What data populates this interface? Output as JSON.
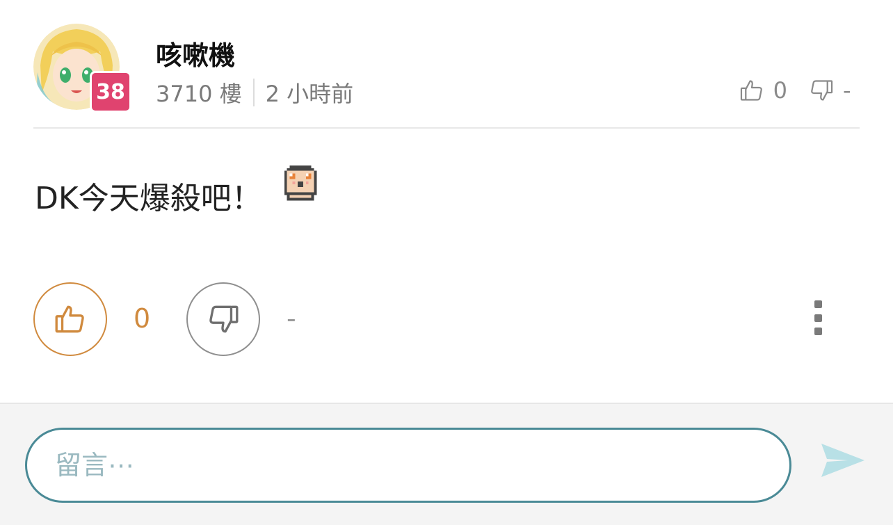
{
  "user": {
    "name": "咳嗽機",
    "level": "38",
    "avatar_icon": "anime-girl-avatar"
  },
  "meta": {
    "floor": "3710 樓",
    "time": "2 小時前"
  },
  "top_votes": {
    "like_icon": "thumbs-up-icon",
    "like_count": "0",
    "dislike_icon": "thumbs-down-icon",
    "dislike_count": "-"
  },
  "post": {
    "text": "DK今天爆殺吧！",
    "sticker": "pixel-emoji-sticker"
  },
  "actions": {
    "like_count": "0",
    "dislike_count": "-",
    "more_icon": "more-vertical-icon"
  },
  "comment": {
    "placeholder": "留言⋯"
  },
  "colors": {
    "like_accent": "#d08a3e",
    "input_border": "#4a8a96",
    "send_icon": "#b8e0e6",
    "level_badge": "#e0436f"
  }
}
